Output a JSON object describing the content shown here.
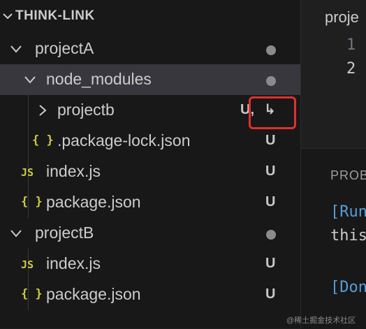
{
  "explorer": {
    "section_title": "THINK-LINK",
    "rows": [
      {
        "label": "projectA",
        "type": "folder-open",
        "decoration": "dot"
      },
      {
        "label": "node_modules",
        "type": "folder-open",
        "decoration": "dot",
        "selected": true
      },
      {
        "label": "projectb",
        "type": "folder-closed",
        "status": "U,",
        "symlink": "↳"
      },
      {
        "label": ".package-lock.json",
        "type": "json",
        "icon": "{ }",
        "status": "U"
      },
      {
        "label": "index.js",
        "type": "js",
        "icon": "JS",
        "status": "U"
      },
      {
        "label": "package.json",
        "type": "json",
        "icon": "{ }",
        "status": "U"
      },
      {
        "label": "projectB",
        "type": "folder-open",
        "decoration": "dot"
      },
      {
        "label": "index.js",
        "type": "js",
        "icon": "JS",
        "status": "U"
      },
      {
        "label": "package.json",
        "type": "json",
        "icon": "{ }",
        "status": "U"
      }
    ]
  },
  "editor": {
    "tab_label": "proje",
    "line_numbers": [
      "1",
      "2"
    ]
  },
  "panel": {
    "title": "PROB",
    "lines": [
      "[Run",
      "this",
      "[Don"
    ]
  },
  "watermark": "@稀土掘金技术社区",
  "colors": {
    "highlight_border": "#e0302b",
    "selected_row": "#37373d",
    "icon_yellow": "#cbcb41"
  }
}
